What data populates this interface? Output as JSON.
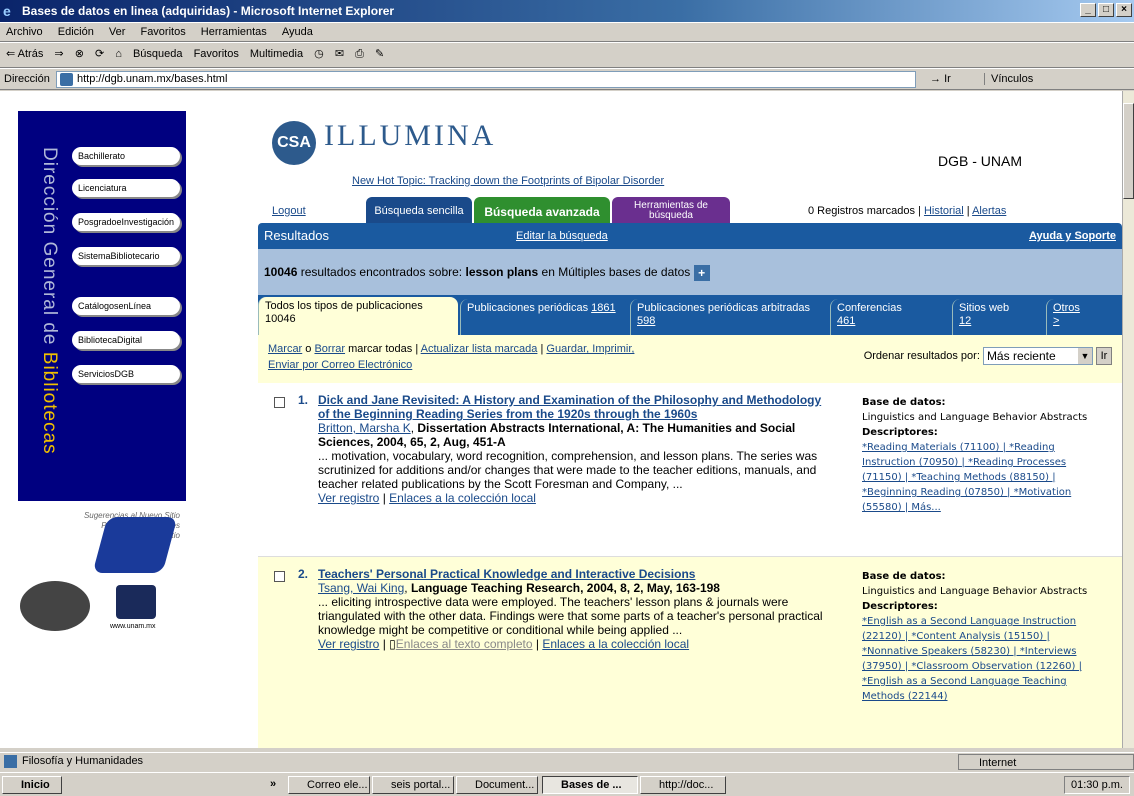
{
  "window": {
    "title": "Bases de datos en linea (adquiridas) - Microsoft Internet Explorer",
    "controls": [
      "_",
      "□",
      "×"
    ]
  },
  "menu": [
    "Archivo",
    "Edición",
    "Ver",
    "Favoritos",
    "Herramientas",
    "Ayuda"
  ],
  "toolbar": {
    "back": "⇐ Atrás",
    "search": "Búsqueda",
    "favorites": "Favoritos",
    "multimedia": "Multimedia"
  },
  "address": {
    "label": "Dirección",
    "url": "http://dgb.unam.mx/bases.html",
    "go": "Ir",
    "links": "Vínculos"
  },
  "left_nav": {
    "vertical_text_a": "Dirección General de ",
    "vertical_text_b": "Bibliotecas",
    "items": [
      "Bachillerato",
      "Licenciatura",
      "PosgradoeInvestigación",
      "SistemaBibliotecario",
      "CatálogosenLínea",
      "BibliotecaDigital",
      "ServiciosDGB"
    ],
    "help_links": [
      "Sugerencias al Nuevo Sitio",
      "Preguntas Frecuentes",
      "Mapa del sitio"
    ],
    "unam": "www.unam.mx"
  },
  "header": {
    "brand_badge": "CSA",
    "brand": "ILLUMINA",
    "hot_topic": "New Hot Topic: Tracking down the Footprints of Bipolar Disorder",
    "org": "DGB - UNAM",
    "logout": "Logout",
    "tabs": [
      "Búsqueda sencilla",
      "Búsqueda avanzada",
      "Herramientas de búsqueda"
    ],
    "marked_prefix": "0 Registros marcados |",
    "history": "Historial",
    "sep": "|",
    "alerts": "Alertas"
  },
  "results_bar": {
    "title": "Resultados",
    "edit": "Editar la búsqueda",
    "help": "Ayuda y Soporte"
  },
  "count": {
    "number": "10046",
    "mid": " resultados encontrados sobre: ",
    "query": "lesson plans",
    "suffix": " en Múltiples bases de datos",
    "plus": "+"
  },
  "pub_tabs": [
    {
      "label": "Todos los tipos de publicaciones 10046",
      "count": ""
    },
    {
      "label": "Publicaciones periódicas",
      "count": "1861"
    },
    {
      "label": "Publicaciones periódicas arbitradas",
      "count": "598"
    },
    {
      "label": "Conferencias",
      "count": "461"
    },
    {
      "label": "Sitios web",
      "count": "12"
    },
    {
      "label": "Otros",
      "count": ">"
    }
  ],
  "controls": {
    "mark": "Marcar",
    "o": " o ",
    "clear": "Borrar",
    "mark_all": " marcar todas | ",
    "update": "Actualizar lista marcada",
    "sep": " | ",
    "save": "Guardar, Imprimir,",
    "email": "Enviar por Correo Electrónico",
    "sort_label": "Ordenar resultados por:",
    "sort_value": "Más reciente",
    "sort_go": "Ir"
  },
  "records": [
    {
      "n": "1.",
      "title": "Dick and Jane Revisited: A History and Examination of the Philosophy and Methodology of the Beginning Reading Series from the 1920s through the 1960s",
      "author": "Britton, Marsha K",
      "source": "Dissertation Abstracts International, A: The Humanities and Social Sciences, 2004, 65, 2, Aug, 451-A",
      "snippet": "... motivation, vocabulary, word recognition, comprehension, and lesson plans. The series was scrutinized for additions and/or changes that were made to the teacher editions, manuals, and teacher related publications by the Scott Foresman and Company, ...",
      "link1": "Ver registro",
      "link2": "",
      "link3": "Enlaces a la colección local",
      "db_label": "Base de datos:",
      "db": "Linguistics and Language Behavior Abstracts",
      "desc_label": "Descriptores:",
      "desc": "*Reading Materials (71100) | *Reading Instruction (70950) | *Reading Processes (71150) | *Teaching Methods (88150) | *Beginning Reading (07850) | *Motivation (55580) | Más..."
    },
    {
      "n": "2.",
      "title": "Teachers' Personal Practical Knowledge and Interactive Decisions",
      "author": "Tsang, Wai King",
      "source": "Language Teaching Research, 2004, 8, 2, May, 163-198",
      "snippet": "... eliciting introspective data were employed. The teachers' lesson plans & journals were triangulated with the other data. Findings were that some parts of a teacher's personal practical knowledge might be competitive or conditional while being applied ...",
      "link1": "Ver registro",
      "link2": "Enlaces al texto completo",
      "link3": "Enlaces a la colección local",
      "db_label": "Base de datos:",
      "db": "Linguistics and Language Behavior Abstracts",
      "desc_label": "Descriptores:",
      "desc": "*English as a Second Language Instruction (22120) | *Content Analysis (15150) | *Nonnative Speakers (58230) | *Interviews (37950) | *Classroom Observation (12260) | *English as a Second Language Teaching Methods (22144)"
    }
  ],
  "status": {
    "text": "Filosofía y Humanidades",
    "zone": "Internet"
  },
  "taskbar": {
    "start": "Inicio",
    "more": "»",
    "tasks": [
      "Correo ele...",
      "seis portal...",
      "Document...",
      "Bases de ...",
      "http://doc..."
    ],
    "clock": "01:30 p.m."
  }
}
